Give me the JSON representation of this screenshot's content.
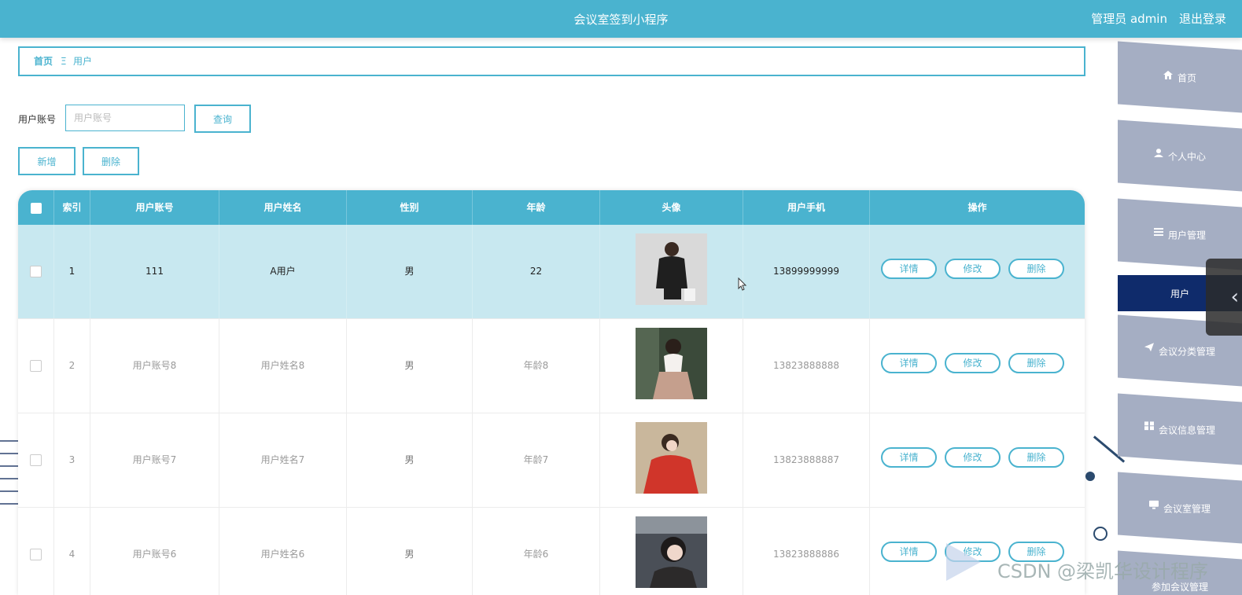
{
  "header": {
    "app_title": "会议室签到小程序",
    "admin_label": "管理员 admin",
    "logout_label": "退出登录"
  },
  "breadcrumb": {
    "home": "首页",
    "separator": "Ξ",
    "current": "用户"
  },
  "search": {
    "label": "用户账号",
    "placeholder": "用户账号",
    "query_button": "查询"
  },
  "actions": {
    "add_button": "新增",
    "delete_button": "删除"
  },
  "table": {
    "headers": [
      "索引",
      "用户账号",
      "用户姓名",
      "性别",
      "年龄",
      "头像",
      "用户手机",
      "操作"
    ],
    "rows": [
      {
        "index": "1",
        "account": "111",
        "name": "A用户",
        "gender": "男",
        "age": "22",
        "phone": "13899999999",
        "avatar": "avatar-photo-1"
      },
      {
        "index": "2",
        "account": "用户账号8",
        "name": "用户姓名8",
        "gender": "男",
        "age": "年龄8",
        "phone": "13823888888",
        "avatar": "avatar-photo-2"
      },
      {
        "index": "3",
        "account": "用户账号7",
        "name": "用户姓名7",
        "gender": "男",
        "age": "年龄7",
        "phone": "13823888887",
        "avatar": "avatar-photo-3"
      },
      {
        "index": "4",
        "account": "用户账号6",
        "name": "用户姓名6",
        "gender": "男",
        "age": "年龄6",
        "phone": "13823888886",
        "avatar": "avatar-photo-4"
      }
    ],
    "row_buttons": {
      "detail": "详情",
      "edit": "修改",
      "delete": "删除"
    }
  },
  "sidebar": {
    "items": [
      {
        "label": "首页",
        "icon": "home-icon"
      },
      {
        "label": "个人中心",
        "icon": "person-icon"
      },
      {
        "label": "用户管理",
        "icon": "list-icon"
      },
      {
        "label": "用户",
        "icon": ""
      },
      {
        "label": "会议分类管理",
        "icon": "send-icon"
      },
      {
        "label": "会议信息管理",
        "icon": "grid-icon"
      },
      {
        "label": "会议室管理",
        "icon": "monitor-icon"
      },
      {
        "label": "参加会议管理",
        "icon": ""
      }
    ]
  },
  "watermark": "CSDN @梁凯华设计程序",
  "colors": {
    "primary": "#4ab3cf",
    "sidebar": "#a5aec3",
    "sidebar_active": "#0f2b6b",
    "row_highlight": "#c8e8f0"
  }
}
